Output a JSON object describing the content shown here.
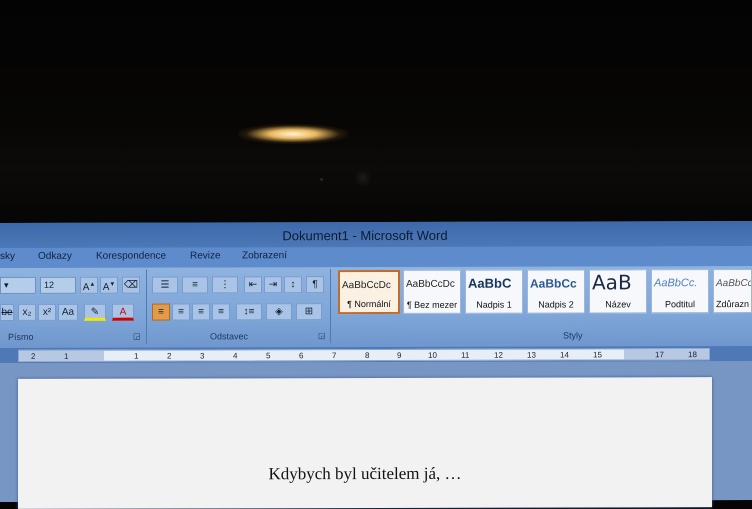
{
  "window": {
    "title": "Dokument1 - Microsoft Word"
  },
  "tabs": [
    "sky",
    "Odkazy",
    "Korespondence",
    "Revize",
    "Zobrazení"
  ],
  "font": {
    "size": "12"
  },
  "groups": {
    "font_label": "Písmo",
    "paragraph_label": "Odstavec",
    "styles_label": "Styly"
  },
  "styles": [
    {
      "sample": "AaBbCcDc",
      "name": "¶ Normální"
    },
    {
      "sample": "AaBbCcDc",
      "name": "¶ Bez mezer"
    },
    {
      "sample": "AaBbC",
      "name": "Nadpis 1"
    },
    {
      "sample": "AaBbCc",
      "name": "Nadpis 2"
    },
    {
      "sample": "AaB",
      "name": "Název"
    },
    {
      "sample": "AaBbCc.",
      "name": "Podtitul"
    },
    {
      "sample": "AaBbCc",
      "name": "Zdůrazn"
    }
  ],
  "ruler": {
    "ticks": [
      "2",
      "1",
      "1",
      "2",
      "3",
      "4",
      "5",
      "6",
      "7",
      "8",
      "9",
      "10",
      "11",
      "12",
      "13",
      "14",
      "15",
      "17",
      "18"
    ]
  },
  "document": {
    "text": "Kdybych byl učitelem já, …"
  },
  "accent": {
    "ribbon": "#7ea6d8",
    "selected_style": "#c36b2e",
    "align_active": "#e39b47"
  }
}
